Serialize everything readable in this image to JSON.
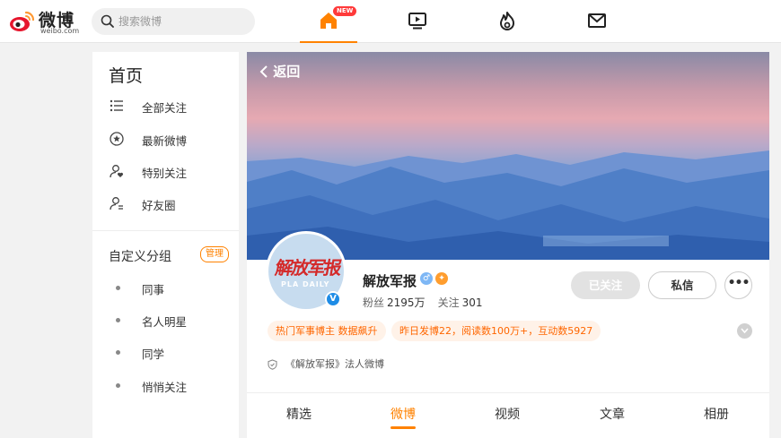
{
  "brand": {
    "name": "微博",
    "domain": "weibo.com"
  },
  "search": {
    "placeholder": "搜索微博"
  },
  "topnav": {
    "items": [
      {
        "icon": "home-icon",
        "active": true,
        "badge": "NEW"
      },
      {
        "icon": "video-icon",
        "active": false
      },
      {
        "icon": "hot-flame-icon",
        "active": false
      },
      {
        "icon": "mail-icon",
        "active": false
      }
    ]
  },
  "sidebar": {
    "title": "首页",
    "items": [
      {
        "label": "全部关注",
        "icon": "list-icon"
      },
      {
        "label": "最新微博",
        "icon": "star-circle-icon"
      },
      {
        "label": "特别关注",
        "icon": "user-heart-icon"
      },
      {
        "label": "好友圈",
        "icon": "user-friends-icon"
      }
    ],
    "group_title": "自定义分组",
    "manage_label": "管理",
    "groups": [
      {
        "label": "同事"
      },
      {
        "label": "名人明星"
      },
      {
        "label": "同学"
      },
      {
        "label": "悄悄关注"
      }
    ]
  },
  "profile": {
    "back_label": "返回",
    "name": "解放军报",
    "avatar_text": "解放军报",
    "avatar_en": "PLA DAILY",
    "verified_mark": "V",
    "followers_label": "粉丝",
    "followers_value": "2195万",
    "following_label": "关注",
    "following_value": "301",
    "followed_button": "已关注",
    "message_button": "私信",
    "more_button": "•••",
    "tags": [
      "热门军事博主 数据飙升",
      "昨日发博22，阅读数100万+，互动数5927"
    ],
    "verification": "《解放军报》法人微博",
    "tabs": [
      {
        "label": "精选",
        "active": false
      },
      {
        "label": "微博",
        "active": true
      },
      {
        "label": "视频",
        "active": false
      },
      {
        "label": "文章",
        "active": false
      },
      {
        "label": "相册",
        "active": false
      }
    ]
  },
  "colors": {
    "accent": "#ff8200",
    "verified": "#1e8ce6",
    "tag_bg": "#fff2e8",
    "tag_text": "#ff6600"
  }
}
